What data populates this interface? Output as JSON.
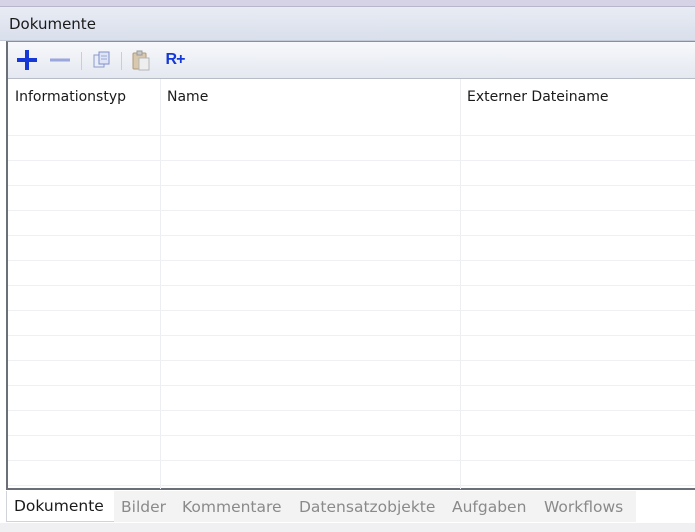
{
  "panel": {
    "title": "Dokumente"
  },
  "toolbar": {
    "buttons": [
      {
        "name": "add",
        "icon": "plus-icon",
        "color": "#1538d6"
      },
      {
        "name": "remove",
        "icon": "minus-icon",
        "color": "#9aa6dc"
      },
      {
        "name": "copy",
        "icon": "copy-icon",
        "color": "#7f8fc8"
      },
      {
        "name": "paste",
        "icon": "paste-icon",
        "color": "#b7a48a"
      },
      {
        "name": "add-relation",
        "icon": "r-plus-icon",
        "label": "R+",
        "color": "#1538d6"
      }
    ]
  },
  "grid": {
    "columns": [
      "Informationstyp",
      "Name",
      "Externer Dateiname"
    ],
    "rows": [
      [
        "",
        "",
        ""
      ],
      [
        "",
        "",
        ""
      ],
      [
        "",
        "",
        ""
      ],
      [
        "",
        "",
        ""
      ],
      [
        "",
        "",
        ""
      ],
      [
        "",
        "",
        ""
      ],
      [
        "",
        "",
        ""
      ],
      [
        "",
        "",
        ""
      ],
      [
        "",
        "",
        ""
      ],
      [
        "",
        "",
        ""
      ],
      [
        "",
        "",
        ""
      ],
      [
        "",
        "",
        ""
      ],
      [
        "",
        "",
        ""
      ],
      [
        "",
        "",
        ""
      ]
    ]
  },
  "tabs": [
    {
      "label": "Dokumente",
      "active": true
    },
    {
      "label": "Bilder",
      "active": false
    },
    {
      "label": "Kommentare",
      "active": false
    },
    {
      "label": "Datensatzobjekte",
      "active": false
    },
    {
      "label": "Aufgaben",
      "active": false
    },
    {
      "label": "Workflows",
      "active": false
    }
  ]
}
